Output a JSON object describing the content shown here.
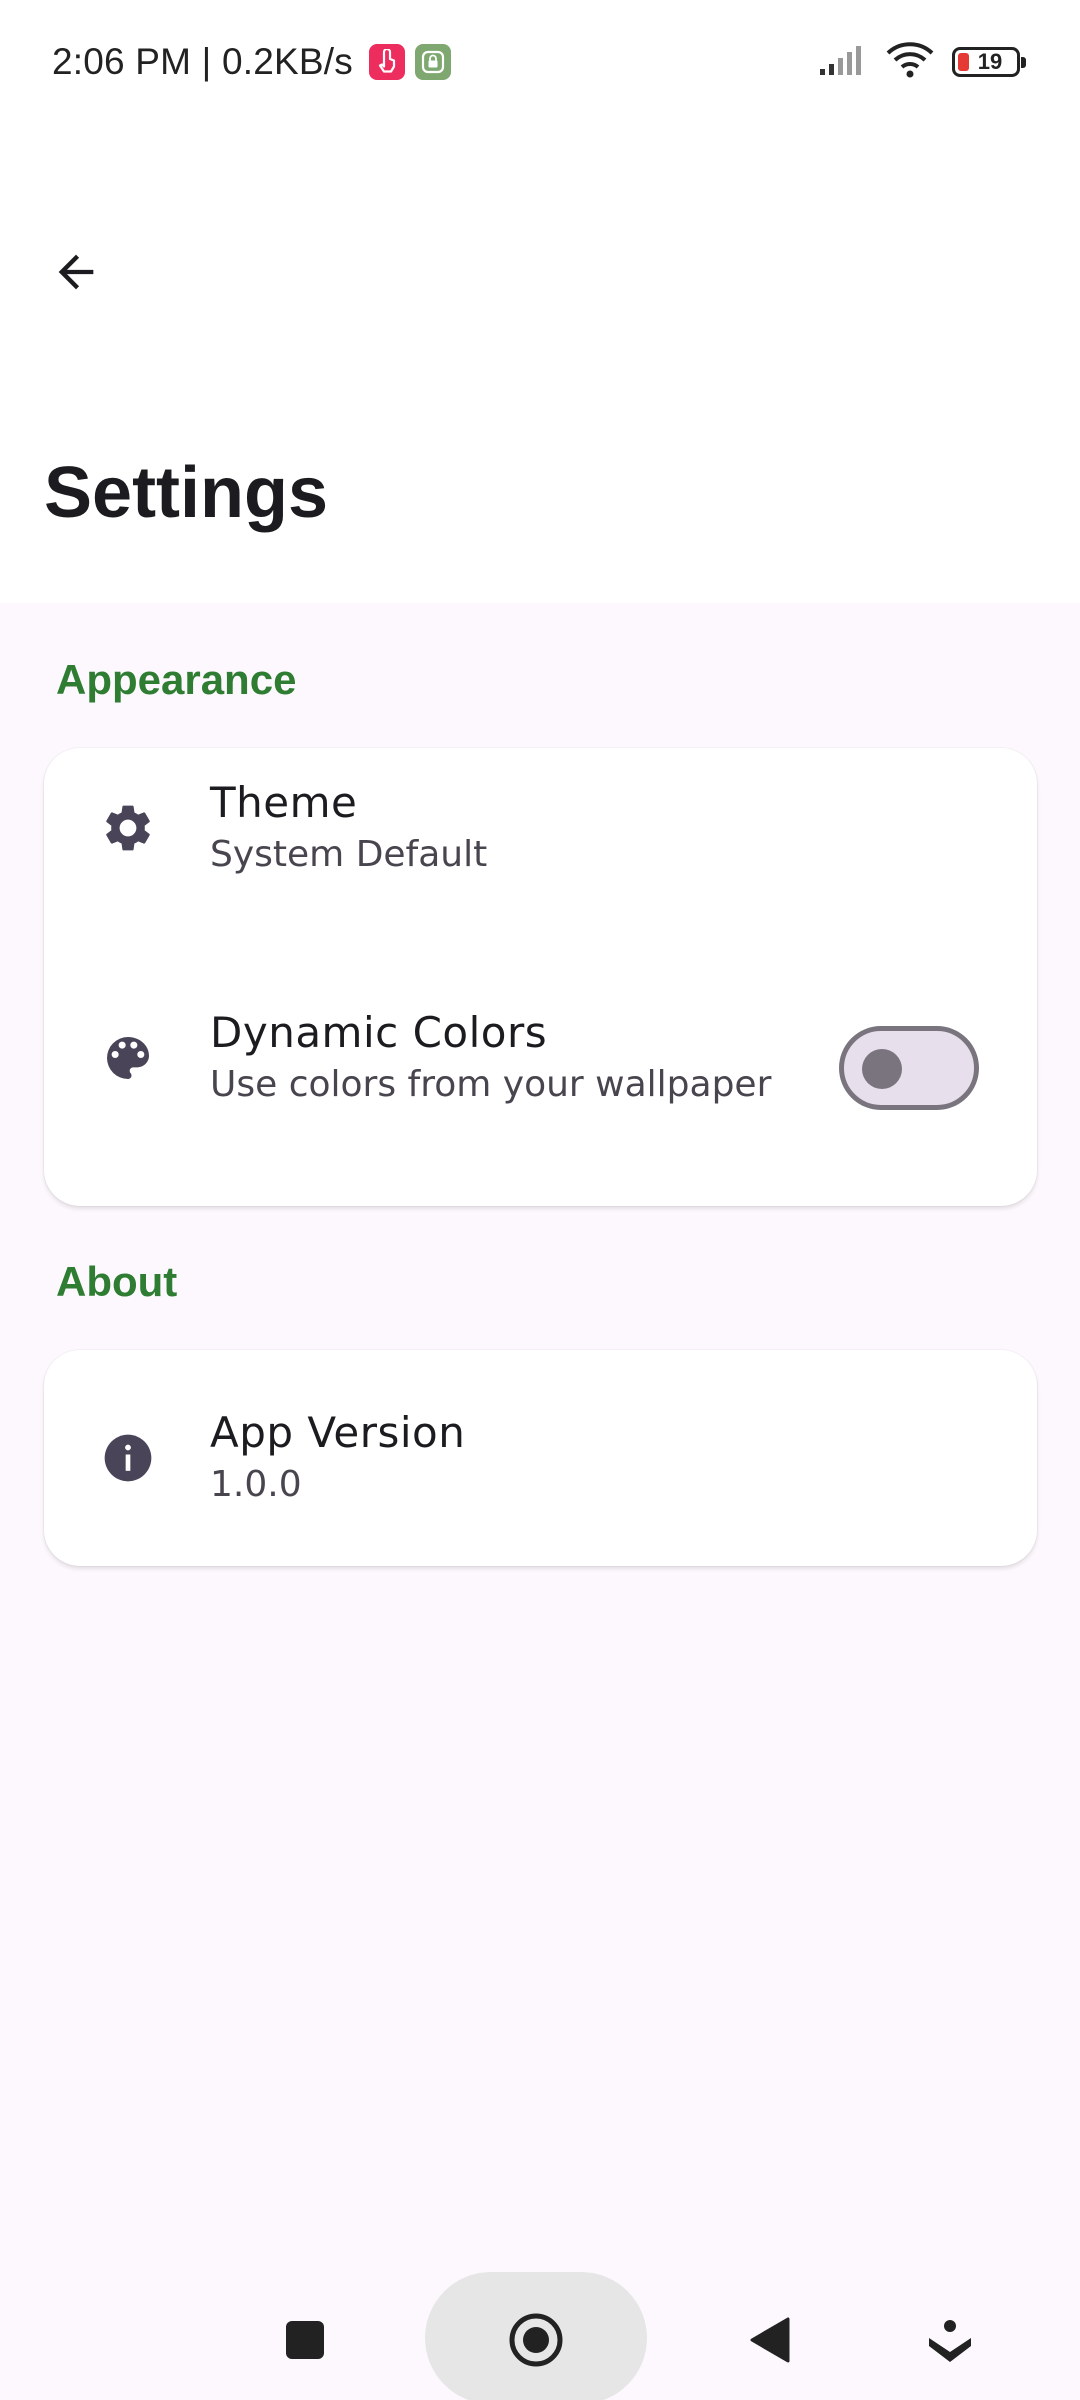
{
  "status_bar": {
    "time_speed": "2:06 PM | 0.2KB/s",
    "battery_level": "19",
    "battery_fraction": 0.19
  },
  "header": {
    "back_icon": "arrow-back-icon",
    "title": "Settings"
  },
  "sections": {
    "appearance": {
      "header": "Appearance",
      "theme": {
        "icon": "gear-icon",
        "title": "Theme",
        "value": "System Default"
      },
      "dynamic_colors": {
        "icon": "palette-icon",
        "title": "Dynamic Colors",
        "subtitle": "Use colors from your wallpaper",
        "enabled": false
      }
    },
    "about": {
      "header": "About",
      "version": {
        "icon": "info-icon",
        "title": "App Version",
        "value": "1.0.0"
      }
    }
  },
  "colors": {
    "section_header": "#2e7d32",
    "background": "#fdf8fd",
    "card": "#ffffff",
    "icon": "#4a4458"
  },
  "nav_bar": {
    "recents_icon": "square-icon",
    "home_icon": "circle-home-icon",
    "back_icon": "triangle-back-icon",
    "extra_icon": "chevron-down-icon"
  }
}
